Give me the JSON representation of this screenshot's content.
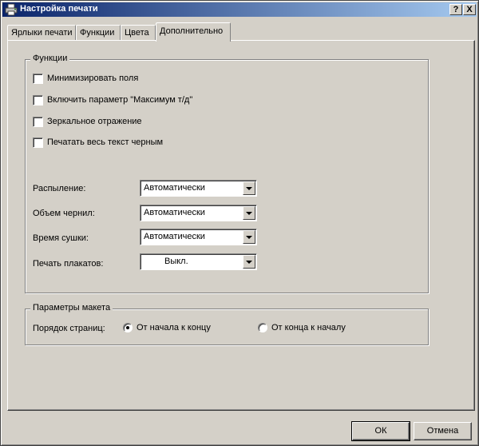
{
  "window": {
    "title": "Настройка печати",
    "help_label": "?",
    "close_label": "X"
  },
  "tabs": [
    {
      "label": "Ярлыки печати"
    },
    {
      "label": "Функции"
    },
    {
      "label": "Цвета"
    },
    {
      "label": "Дополнительно",
      "active": true
    }
  ],
  "functions_group": {
    "legend": "Функции",
    "checkboxes": [
      {
        "label": "Минимизировать поля",
        "checked": false
      },
      {
        "label": "Включить параметр \"Максимум т/д\"",
        "checked": false
      },
      {
        "label": "Зеркальное отражение",
        "checked": false
      },
      {
        "label": "Печатать весь текст черным",
        "checked": false
      }
    ],
    "dropdowns": [
      {
        "label": "Распыление:",
        "value": "Автоматически"
      },
      {
        "label": "Объем чернил:",
        "value": "Автоматически"
      },
      {
        "label": "Время сушки:",
        "value": "Автоматически"
      },
      {
        "label": "Печать плакатов:",
        "value": "Выкл."
      }
    ]
  },
  "layout_group": {
    "legend": "Параметры макета",
    "page_order_label": "Порядок страниц:",
    "options": [
      {
        "label": "От начала к концу",
        "selected": true
      },
      {
        "label": "От конца к началу",
        "selected": false
      }
    ]
  },
  "footer": {
    "ok_label": "ОК",
    "cancel_label": "Отмена"
  }
}
